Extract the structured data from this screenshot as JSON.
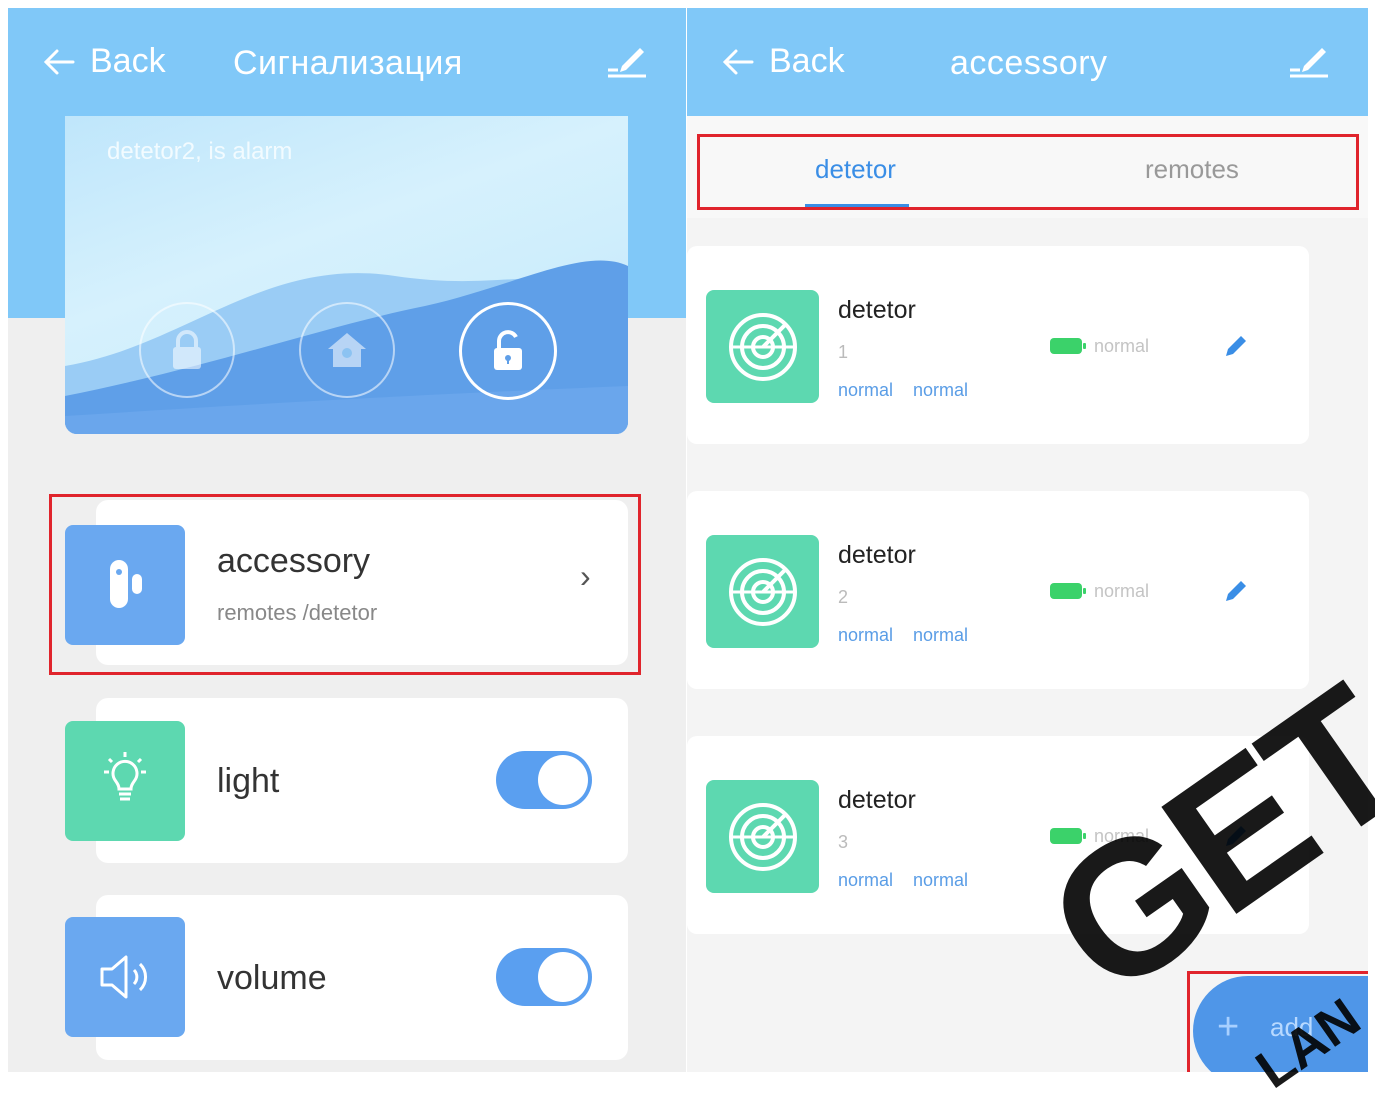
{
  "left": {
    "back_label": "Back",
    "title": "Сигнализация",
    "hero_status": "detetor2, is alarm",
    "accessory": {
      "label": "accessory",
      "sub": "remotes /detetor"
    },
    "light": {
      "label": "light",
      "on": true
    },
    "volume": {
      "label": "volume",
      "on": true
    }
  },
  "right": {
    "back_label": "Back",
    "title": "accessory",
    "tabs": [
      {
        "label": "detetor",
        "active": true
      },
      {
        "label": "remotes",
        "active": false
      }
    ],
    "items": [
      {
        "name": "detetor",
        "num": "1",
        "status1": "normal",
        "status2": "normal",
        "battery": "normal"
      },
      {
        "name": "detetor",
        "num": "2",
        "status1": "normal",
        "status2": "normal",
        "battery": "normal"
      },
      {
        "name": "detetor",
        "num": "3",
        "status1": "normal",
        "status2": "normal",
        "battery": "normal"
      }
    ],
    "add_label": "add"
  },
  "watermark": {
    "main": "GET",
    "sub": "LAN"
  },
  "colors": {
    "header": "#80c8f8",
    "accent": "#3a8ee6",
    "tile_green": "#5dd8b0",
    "tile_blue": "#6aa8f0",
    "highlight": "#e0242c"
  }
}
